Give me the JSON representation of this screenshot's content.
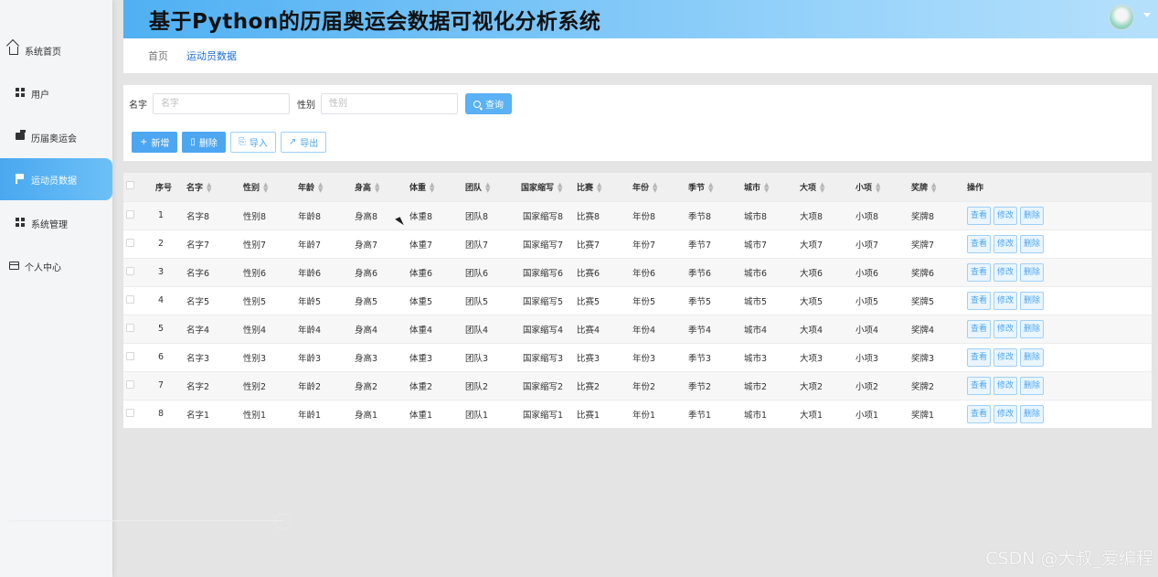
{
  "header": {
    "title": "基于Python的历届奥运会数据可视化分析系统",
    "avatar_icon": "user-avatar",
    "caret_icon": "chevron-down-icon"
  },
  "sidebar": {
    "items": [
      {
        "label": "系统首页",
        "icon": "home-icon",
        "active": false
      },
      {
        "label": "用户",
        "icon": "grid-icon",
        "active": false
      },
      {
        "label": "历届奥运会",
        "icon": "wallet-icon",
        "active": false
      },
      {
        "label": "运动员数据",
        "icon": "flag-icon",
        "active": true
      },
      {
        "label": "系统管理",
        "icon": "grid-icon",
        "active": false
      },
      {
        "label": "个人中心",
        "icon": "profile-icon",
        "active": false
      }
    ]
  },
  "breadcrumb": [
    "首页",
    "运动员数据"
  ],
  "search": {
    "name_label": "名字",
    "name_placeholder": "名字",
    "gender_label": "性别",
    "gender_placeholder": "性别",
    "query_label": "查询"
  },
  "actions": {
    "add": "新增",
    "delete": "删除",
    "import": "导入",
    "export": "导出"
  },
  "table": {
    "columns": [
      "序号",
      "名字",
      "性别",
      "年龄",
      "身高",
      "体重",
      "团队",
      "国家缩写",
      "比赛",
      "年份",
      "季节",
      "城市",
      "大项",
      "小项",
      "奖牌",
      "操作"
    ],
    "row_actions": {
      "view": "查看",
      "edit": "修改",
      "delete": "删除"
    },
    "rows": [
      [
        "1",
        "名字8",
        "性别8",
        "年龄8",
        "身高8",
        "体重8",
        "团队8",
        "国家缩写8",
        "比赛8",
        "年份8",
        "季节8",
        "城市8",
        "大项8",
        "小项8",
        "奖牌8"
      ],
      [
        "2",
        "名字7",
        "性别7",
        "年龄7",
        "身高7",
        "体重7",
        "团队7",
        "国家缩写7",
        "比赛7",
        "年份7",
        "季节7",
        "城市7",
        "大项7",
        "小项7",
        "奖牌7"
      ],
      [
        "3",
        "名字6",
        "性别6",
        "年龄6",
        "身高6",
        "体重6",
        "团队6",
        "国家缩写6",
        "比赛6",
        "年份6",
        "季节6",
        "城市6",
        "大项6",
        "小项6",
        "奖牌6"
      ],
      [
        "4",
        "名字5",
        "性别5",
        "年龄5",
        "身高5",
        "体重5",
        "团队5",
        "国家缩写5",
        "比赛5",
        "年份5",
        "季节5",
        "城市5",
        "大项5",
        "小项5",
        "奖牌5"
      ],
      [
        "5",
        "名字4",
        "性别4",
        "年龄4",
        "身高4",
        "体重4",
        "团队4",
        "国家缩写4",
        "比赛4",
        "年份4",
        "季节4",
        "城市4",
        "大项4",
        "小项4",
        "奖牌4"
      ],
      [
        "6",
        "名字3",
        "性别3",
        "年龄3",
        "身高3",
        "体重3",
        "团队3",
        "国家缩写3",
        "比赛3",
        "年份3",
        "季节3",
        "城市3",
        "大项3",
        "小项3",
        "奖牌3"
      ],
      [
        "7",
        "名字2",
        "性别2",
        "年龄2",
        "身高2",
        "体重2",
        "团队2",
        "国家缩写2",
        "比赛2",
        "年份2",
        "季节2",
        "城市2",
        "大项2",
        "小项2",
        "奖牌2"
      ],
      [
        "8",
        "名字1",
        "性别1",
        "年龄1",
        "身高1",
        "体重1",
        "团队1",
        "国家缩写1",
        "比赛1",
        "年份1",
        "季节1",
        "城市1",
        "大项1",
        "小项1",
        "奖牌1"
      ]
    ]
  },
  "watermark": "CSDN @大叔_爱编程",
  "colors": {
    "accent": "#4da6f0",
    "header_start": "#4fb0f3",
    "header_end": "#b5e0fb"
  }
}
